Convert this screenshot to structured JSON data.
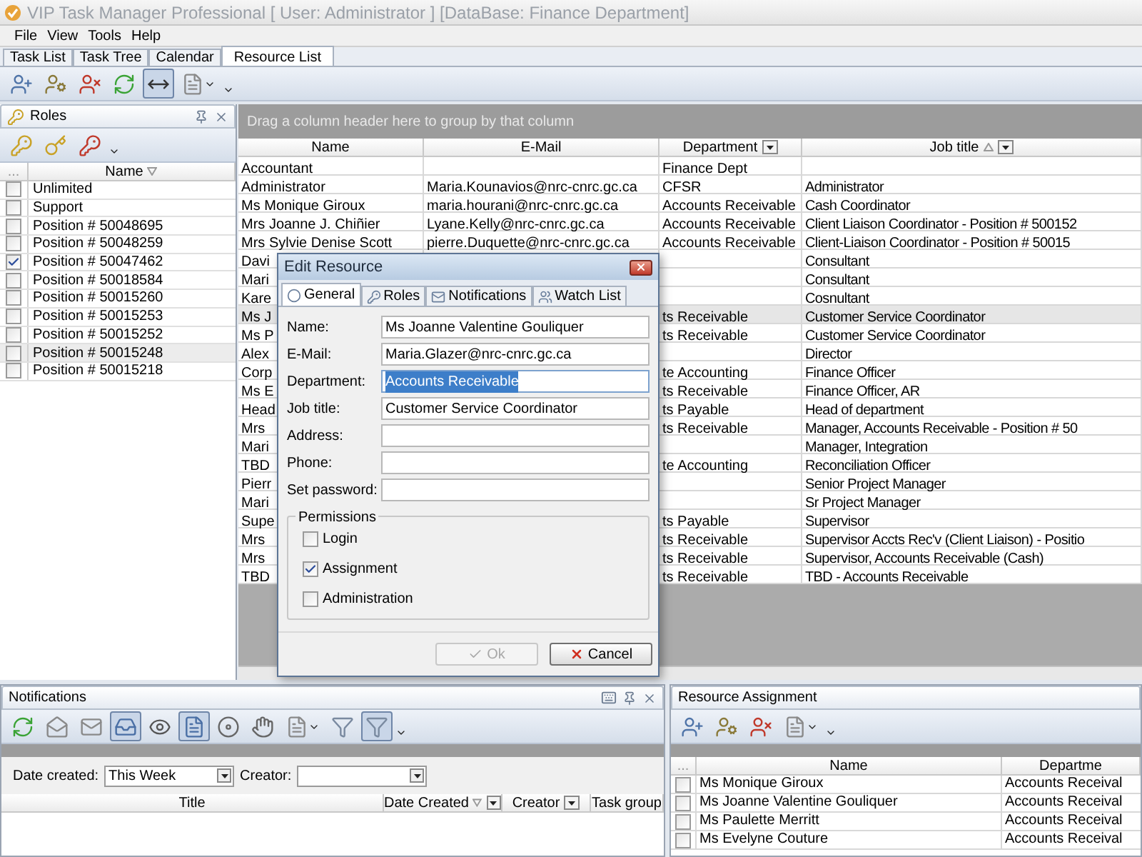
{
  "window": {
    "title": "VIP Task Manager Professional [ User: Administrator ] [DataBase: Finance Department]"
  },
  "menu": [
    "File",
    "View",
    "Tools",
    "Help"
  ],
  "tabs": [
    {
      "label": "Task List",
      "selected": false
    },
    {
      "label": "Task Tree",
      "selected": false
    },
    {
      "label": "Calendar",
      "selected": false
    },
    {
      "label": "Resource List",
      "selected": true
    }
  ],
  "toolbar": [
    {
      "kind": "user-add",
      "pressed": false
    },
    {
      "kind": "user-edit",
      "pressed": false
    },
    {
      "kind": "user-delete",
      "pressed": false
    },
    {
      "kind": "refresh",
      "pressed": false
    },
    {
      "kind": "fit",
      "pressed": true
    },
    {
      "kind": "report",
      "pressed": false
    }
  ],
  "roles": {
    "title": "Roles",
    "toolbar": [
      {
        "kind": "key-add",
        "pressed": false
      },
      {
        "kind": "key-edit",
        "pressed": false
      },
      {
        "kind": "key-delete",
        "pressed": false
      }
    ],
    "columns": [
      {
        "label": "..."
      },
      {
        "label": "Name",
        "sort_desc": true
      }
    ],
    "items": [
      {
        "name": "Unlimited",
        "checked": false,
        "selected": false
      },
      {
        "name": "Support",
        "checked": false,
        "selected": false
      },
      {
        "name": "Position # 50048695",
        "checked": false,
        "selected": false
      },
      {
        "name": "Position # 50048259",
        "checked": false,
        "selected": false
      },
      {
        "name": "Position # 50047462",
        "checked": true,
        "selected": false
      },
      {
        "name": "Position # 50018584",
        "checked": false,
        "selected": false
      },
      {
        "name": "Position # 50015260",
        "checked": false,
        "selected": false
      },
      {
        "name": "Position # 50015253",
        "checked": false,
        "selected": false
      },
      {
        "name": "Position # 50015252",
        "checked": false,
        "selected": false
      },
      {
        "name": "Position # 50015248",
        "checked": false,
        "selected": true
      },
      {
        "name": "Position # 50015218",
        "checked": false,
        "selected": false
      }
    ]
  },
  "resources": {
    "group_hint": "Drag a column header here to group by that column",
    "columns": [
      {
        "label": "Name"
      },
      {
        "label": "E-Mail"
      },
      {
        "label": "Department",
        "filter_button": true
      },
      {
        "label": "Job title",
        "sort_asc": true,
        "filter_button": true
      }
    ],
    "rows": [
      {
        "name": "Accountant",
        "department": "Finance Dept",
        "selected": false
      },
      {
        "name": "Administrator",
        "email": "Maria.Kounavios@nrc-cnrc.gc.ca",
        "department": "CFSR",
        "job_title": "Administrator",
        "selected": false
      },
      {
        "name": "Ms Monique Giroux",
        "email": "maria.hourani@nrc-cnrc.gc.ca",
        "department": "Accounts Receivable",
        "job_title": "Cash Coordinator",
        "selected": false
      },
      {
        "name": "Mrs Joanne J. Chiñier",
        "email": "Lyane.Kelly@nrc-cnrc.gc.ca",
        "department": "Accounts Receivable",
        "job_title": "Client Liaison Coordinator - Position # 500152",
        "selected": false
      },
      {
        "name": "Mrs Sylvie Denise Scott",
        "email": "pierre.Duquette@nrc-cnrc.gc.ca",
        "department": "Accounts Receivable",
        "job_title": "Client-Liaison Coordinator  -  Position # 50015",
        "selected": false
      },
      {
        "name": "Davi",
        "job_title": "Consultant",
        "selected": false
      },
      {
        "name": "Mari",
        "job_title": "Consultant",
        "selected": false
      },
      {
        "name": "Kare",
        "job_title": "Cosnultant",
        "selected": false
      },
      {
        "name": "Ms J",
        "department": "ts Receivable",
        "job_title": "Customer Service Coordinator",
        "selected": true
      },
      {
        "name": "Ms P",
        "department": "ts Receivable",
        "job_title": "Customer Service Coordinator",
        "selected": false
      },
      {
        "name": "Alex",
        "job_title": "Director",
        "selected": false
      },
      {
        "name": "Corp",
        "department": "te Accounting",
        "job_title": "Finance Officer",
        "selected": false
      },
      {
        "name": "Ms E",
        "department": "ts Receivable",
        "job_title": "Finance Officer, AR",
        "selected": false
      },
      {
        "name": "Head",
        "department": "ts Payable",
        "job_title": "Head of department",
        "selected": false
      },
      {
        "name": "Mrs",
        "department": "ts Receivable",
        "job_title": "Manager, Accounts Receivable - Position # 50",
        "selected": false
      },
      {
        "name": "Mari",
        "job_title": "Manager, Integration",
        "selected": false
      },
      {
        "name": "TBD",
        "department": "te Accounting",
        "job_title": "Reconciliation Officer",
        "selected": false
      },
      {
        "name": "Pierr",
        "job_title": "Senior Project Manager",
        "selected": false
      },
      {
        "name": "Mari",
        "job_title": "Sr Project Manager",
        "selected": false
      },
      {
        "name": "Supe",
        "department": "ts Payable",
        "job_title": "Supervisor",
        "selected": false
      },
      {
        "name": "Mrs",
        "department": "ts Receivable",
        "job_title": "Supervisor Accts Rec'v (Client Liaison) - Positio",
        "selected": false
      },
      {
        "name": "Mrs",
        "department": "ts Receivable",
        "job_title": "Supervisor, Accounts Receivable (Cash)",
        "selected": false
      },
      {
        "name": "TBD",
        "department": "ts Receivable",
        "job_title": "TBD - Accounts Receivable",
        "selected": false
      }
    ]
  },
  "dialog": {
    "title": "Edit Resource",
    "tabs": [
      {
        "label": "General",
        "kind": "general",
        "selected": true
      },
      {
        "label": "Roles",
        "kind": "roles",
        "selected": false
      },
      {
        "label": "Notifications",
        "kind": "notifications",
        "selected": false
      },
      {
        "label": "Watch List",
        "kind": "watch",
        "selected": false
      }
    ],
    "fields": [
      {
        "label": "Name:",
        "value": "Ms Joanne Valentine Gouliquer",
        "selected": false
      },
      {
        "label": "E-Mail:",
        "value": "Maria.Glazer@nrc-cnrc.gc.ca",
        "selected": false
      },
      {
        "label": "Department:",
        "value": "Accounts Receivable",
        "selected": true
      },
      {
        "label": "Job title:",
        "value": "Customer Service Coordinator",
        "selected": false
      },
      {
        "label": "Address:",
        "selected": false
      },
      {
        "label": "Phone:",
        "selected": false
      },
      {
        "label": "Set password:",
        "selected": false
      }
    ],
    "permissions": {
      "title": "Permissions",
      "options": [
        {
          "label": "Login",
          "checked": false
        },
        {
          "label": "Assignment",
          "checked": true
        },
        {
          "label": "Administration",
          "checked": false
        }
      ]
    },
    "buttons": [
      {
        "label": "Ok",
        "kind": "ok",
        "disabled": true
      },
      {
        "label": "Cancel",
        "kind": "cancel",
        "disabled": false
      }
    ]
  },
  "notifications": {
    "title": "Notifications",
    "toolbar": [
      {
        "kind": "refresh",
        "pressed": false
      },
      {
        "kind": "mail-read",
        "pressed": false
      },
      {
        "kind": "mail-unread",
        "pressed": false
      },
      {
        "kind": "inbox",
        "pressed": true
      },
      {
        "kind": "mail-view",
        "pressed": false
      },
      {
        "kind": "doc",
        "pressed": true
      },
      {
        "kind": "disc",
        "pressed": false
      },
      {
        "kind": "hand",
        "pressed": false
      },
      {
        "kind": "report",
        "pressed": false
      },
      {
        "kind": "filter",
        "pressed": false
      },
      {
        "kind": "filter",
        "pressed": true
      }
    ],
    "filters": [
      {
        "label": "Date created:",
        "value": "This Week"
      },
      {
        "label": "Creator:"
      }
    ],
    "columns": [
      {
        "label": "Title"
      },
      {
        "label": "Date Created",
        "sort_desc": true,
        "filter_button": true
      },
      {
        "label": "Creator",
        "filter_button": true
      },
      {
        "label": "Task group"
      }
    ]
  },
  "assignment": {
    "title": "Resource Assignment",
    "toolbar": [
      {
        "kind": "user-add",
        "pressed": false
      },
      {
        "kind": "user-edit",
        "pressed": false
      },
      {
        "kind": "user-delete",
        "pressed": false
      },
      {
        "kind": "report",
        "pressed": false
      }
    ],
    "columns": [
      {
        "label": "..."
      },
      {
        "label": "Name"
      },
      {
        "label": "Departme"
      }
    ],
    "rows": [
      {
        "name": "Ms Monique Giroux",
        "department": "Accounts Receival",
        "checked": false
      },
      {
        "name": "Ms Joanne Valentine Gouliquer",
        "department": "Accounts Receival",
        "checked": false
      },
      {
        "name": "Ms Paulette Merritt",
        "department": "Accounts Receival",
        "checked": false
      },
      {
        "name": "Ms Evelyne Couture",
        "department": "Accounts Receival",
        "checked": false
      }
    ]
  }
}
